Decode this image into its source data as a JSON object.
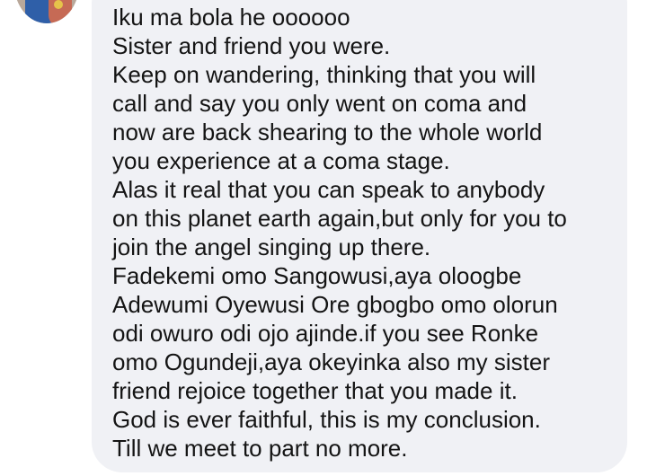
{
  "comment": {
    "lines": [
      "Iku ma bola he oooooo",
      "Sister and friend you were.",
      "Keep on wandering, thinking that you will",
      "call and say you only went on coma and",
      "now are back shearing to the whole world",
      "you experience at a coma stage.",
      "Alas it real that you can speak to anybody",
      "on this planet earth again,but only for you to",
      "join the angel singing up there.",
      "Fadekemi omo Sangowusi,aya oloogbe",
      "Adewumi Oyewusi Ore gbogbo omo olorun",
      "odi owuro odi ojo ajinde.if you see Ronke",
      "omo Ogundeji,aya okeyinka also my sister",
      "friend rejoice together that you made it.",
      "God is ever faithful, this is my conclusion.",
      "Till we meet to part no more."
    ]
  }
}
